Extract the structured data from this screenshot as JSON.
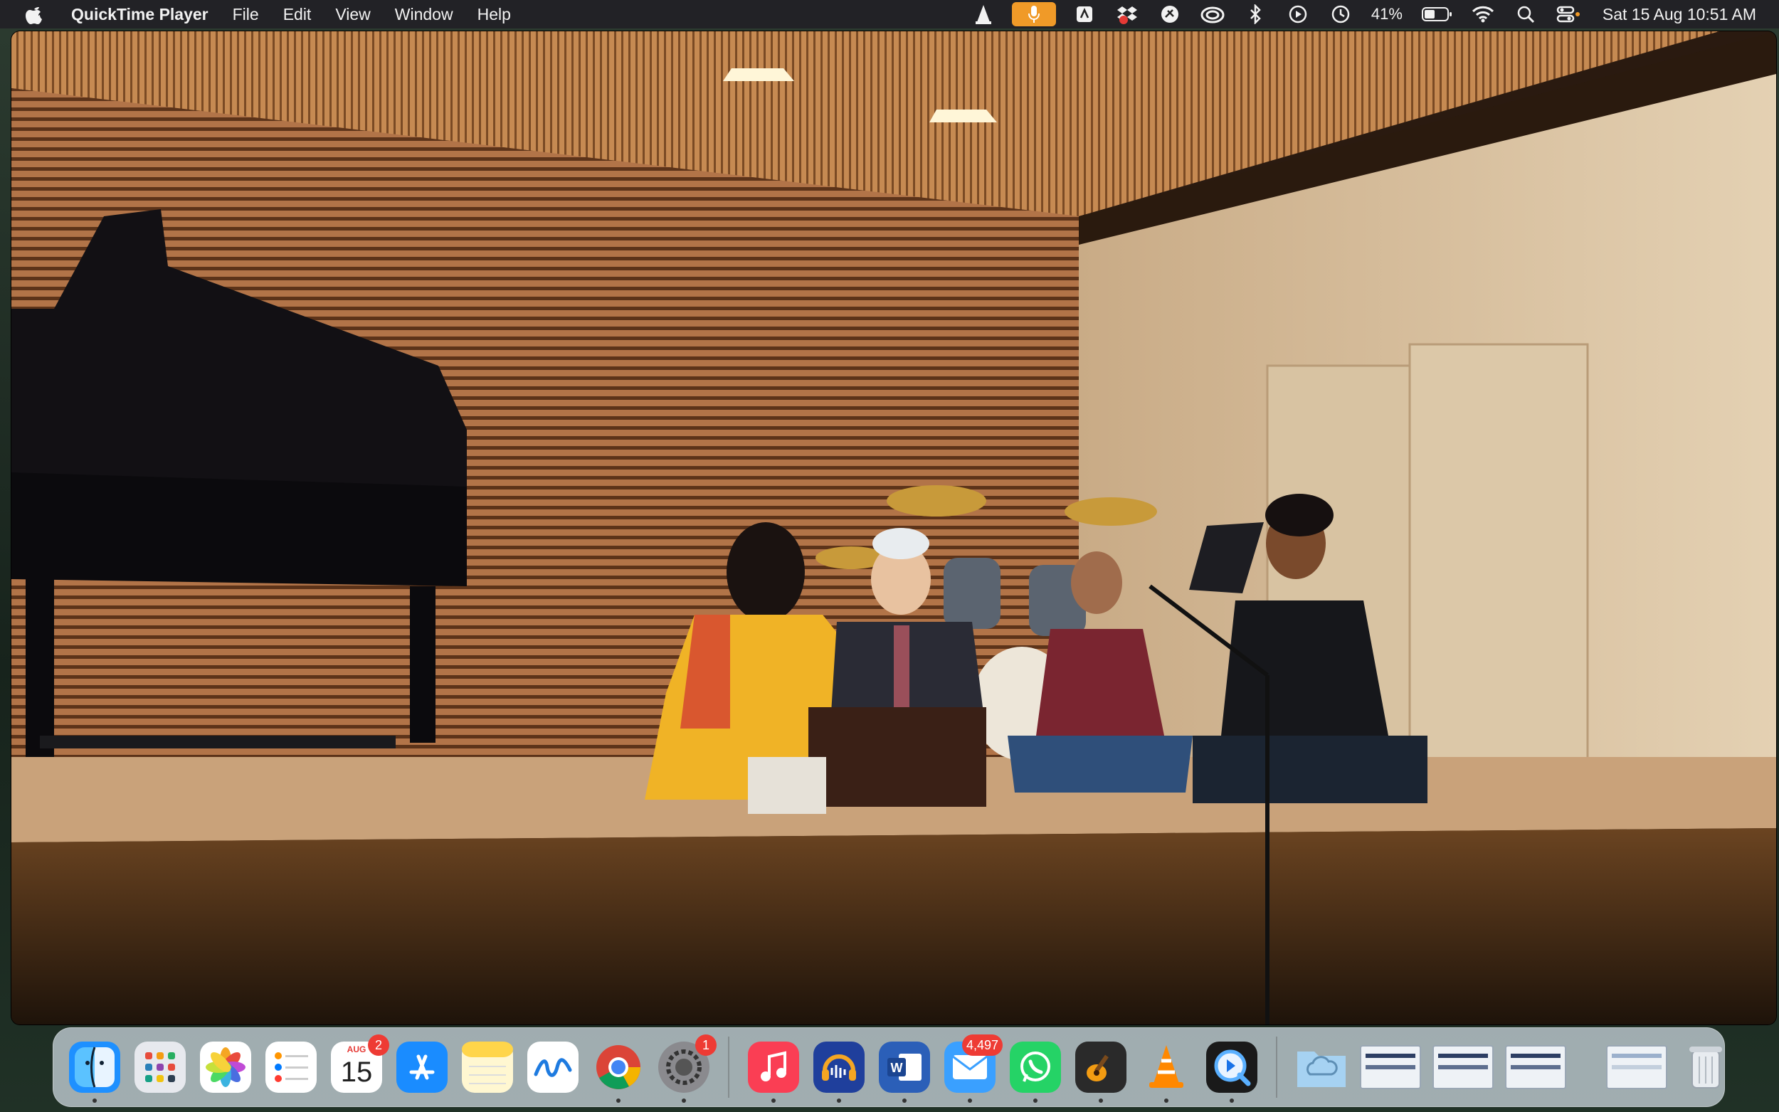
{
  "menubar": {
    "app_name": "QuickTime Player",
    "menus": [
      "File",
      "Edit",
      "View",
      "Window",
      "Help"
    ],
    "status_items": [
      "vlc-icon",
      "microphone-icon",
      "dropbox-icon",
      "creative-cloud-icon",
      "bluetooth-icon",
      "play-icon",
      "time-machine-icon",
      "battery-icon",
      "wifi-icon",
      "search-icon",
      "control-center-icon"
    ],
    "battery": "41%",
    "clock": "Sat 15 Aug  10:51 AM"
  },
  "video": {
    "title": "",
    "colors": {
      "wall": "#a7673c",
      "ceiling": "#b97a45",
      "stage": "#5a3a1e",
      "wall_right": "#d6c0a0"
    }
  },
  "dock": {
    "apps": [
      {
        "name": "finder",
        "icon": "finder-icon",
        "color": "#1e90ff",
        "running": true
      },
      {
        "name": "launchpad",
        "icon": "launchpad-icon",
        "color": "#e7e9ee"
      },
      {
        "name": "photos",
        "icon": "photos-icon",
        "color": "#ffffff"
      },
      {
        "name": "reminders",
        "icon": "reminders-icon",
        "color": "#ffffff"
      },
      {
        "name": "calendar",
        "icon": "calendar-icon",
        "color": "#ffffff",
        "badge": "2",
        "month": "AUG",
        "day": "15"
      },
      {
        "name": "app-store",
        "icon": "app-store-icon",
        "color": "#1a8cff"
      },
      {
        "name": "notes",
        "icon": "notes-icon",
        "color": "#ffd54a"
      },
      {
        "name": "freeform",
        "icon": "freeform-icon",
        "color": "#ffffff"
      },
      {
        "name": "chrome",
        "icon": "chrome-icon",
        "color": "#ffffff",
        "running": true
      },
      {
        "name": "system-settings",
        "icon": "gear-icon",
        "color": "#8a8a8e",
        "badge": "1",
        "running": true
      },
      {
        "name": "music",
        "icon": "music-icon",
        "color": "#fa3e54",
        "running": true
      },
      {
        "name": "audacity",
        "icon": "audacity-icon",
        "color": "#1f3f9c",
        "running": true
      },
      {
        "name": "word",
        "icon": "word-icon",
        "color": "#2b5fb8",
        "running": true
      },
      {
        "name": "mail",
        "icon": "mail-icon",
        "color": "#3aa0ff",
        "badge": "4,497",
        "running": true
      },
      {
        "name": "whatsapp",
        "icon": "whatsapp-icon",
        "color": "#25d366",
        "running": true
      },
      {
        "name": "garageband",
        "icon": "guitar-icon",
        "color": "#2a2a2a",
        "running": true
      },
      {
        "name": "vlc",
        "icon": "vlc-cone-icon",
        "color": "#ff8800",
        "running": true
      },
      {
        "name": "quicktime",
        "icon": "quicktime-icon",
        "color": "#1a1a1a",
        "running": true
      }
    ],
    "right_items": [
      "downloads-folder-icon",
      "minimized-window-1",
      "minimized-window-2",
      "minimized-window-3",
      "minimized-window-4",
      "trash-icon"
    ]
  }
}
